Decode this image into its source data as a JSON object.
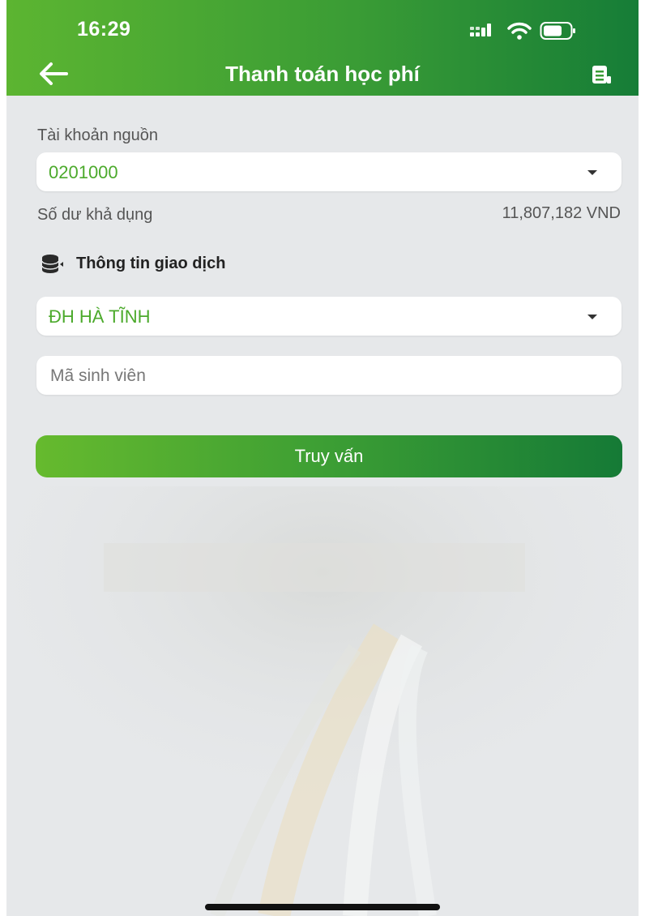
{
  "status_bar": {
    "time": "16:29"
  },
  "header": {
    "title": "Thanh toán học phí",
    "back_icon": "arrow-left-icon",
    "action_icon": "receipt-icon"
  },
  "source_account": {
    "label": "Tài khoản nguồn",
    "value": "0201000",
    "balance_label": "Số dư khả dụng",
    "balance_value": "11,807,182 VND"
  },
  "transaction": {
    "section_title": "Thông tin giao dịch",
    "section_icon": "coins-icon",
    "school": "ĐH HÀ TĨNH",
    "student_id_placeholder": "Mã sinh viên",
    "submit_label": "Truy vấn"
  },
  "colors": {
    "brand_green": "#4caa2c",
    "brand_dark_green": "#167d37",
    "background": "#e6e8ea"
  }
}
